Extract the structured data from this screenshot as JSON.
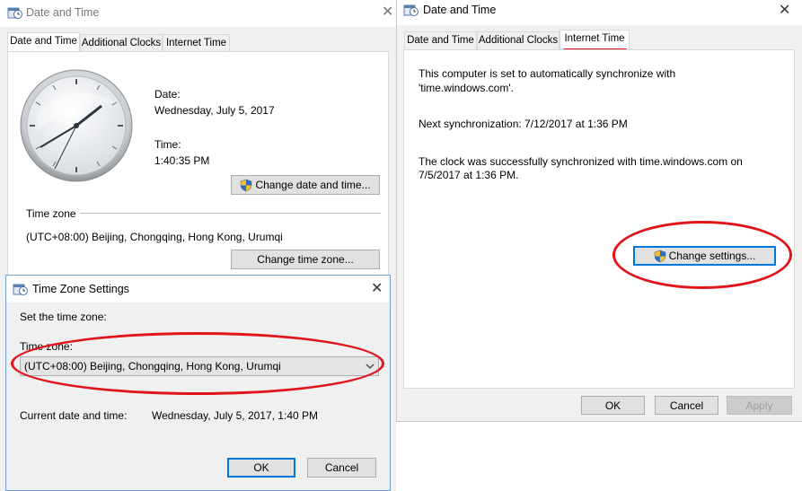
{
  "left_window": {
    "title": "Date and Time",
    "tabs": [
      "Date and Time",
      "Additional Clocks",
      "Internet Time"
    ],
    "date_label": "Date:",
    "date_value": "Wednesday, July 5, 2017",
    "time_label": "Time:",
    "time_value": "1:40:35 PM",
    "change_datetime_button": "Change date and time...",
    "timezone_heading": "Time zone",
    "timezone_value": "(UTC+08:00) Beijing, Chongqing, Hong Kong, Urumqi",
    "change_timezone_button": "Change time zone..."
  },
  "tz_dialog": {
    "title": "Time Zone Settings",
    "set_label": "Set the time zone:",
    "timezone_label": "Time zone:",
    "timezone_selected": "(UTC+08:00) Beijing, Chongqing, Hong Kong, Urumqi",
    "current_label": "Current date and time:",
    "current_value": "Wednesday, July 5, 2017, 1:40 PM",
    "ok": "OK",
    "cancel": "Cancel"
  },
  "right_window": {
    "title": "Date and Time",
    "tabs": [
      "Date and Time",
      "Additional Clocks",
      "Internet Time"
    ],
    "sync_line1": "This computer is set to automatically synchronize with",
    "sync_line2": "'time.windows.com'.",
    "next_sync": "Next synchronization: 7/12/2017 at 1:36 PM",
    "success_line1": "The clock was successfully synchronized with time.windows.com on",
    "success_line2": "7/5/2017 at 1:36 PM.",
    "change_settings_button": "Change settings...",
    "ok": "OK",
    "cancel": "Cancel",
    "apply": "Apply"
  },
  "colors": {
    "annotation_red": "#e0141b",
    "accent_blue": "#0078d7"
  },
  "icons": [
    "clock-app-icon",
    "close-icon",
    "shield-icon",
    "chevron-down-icon",
    "analog-clock"
  ]
}
